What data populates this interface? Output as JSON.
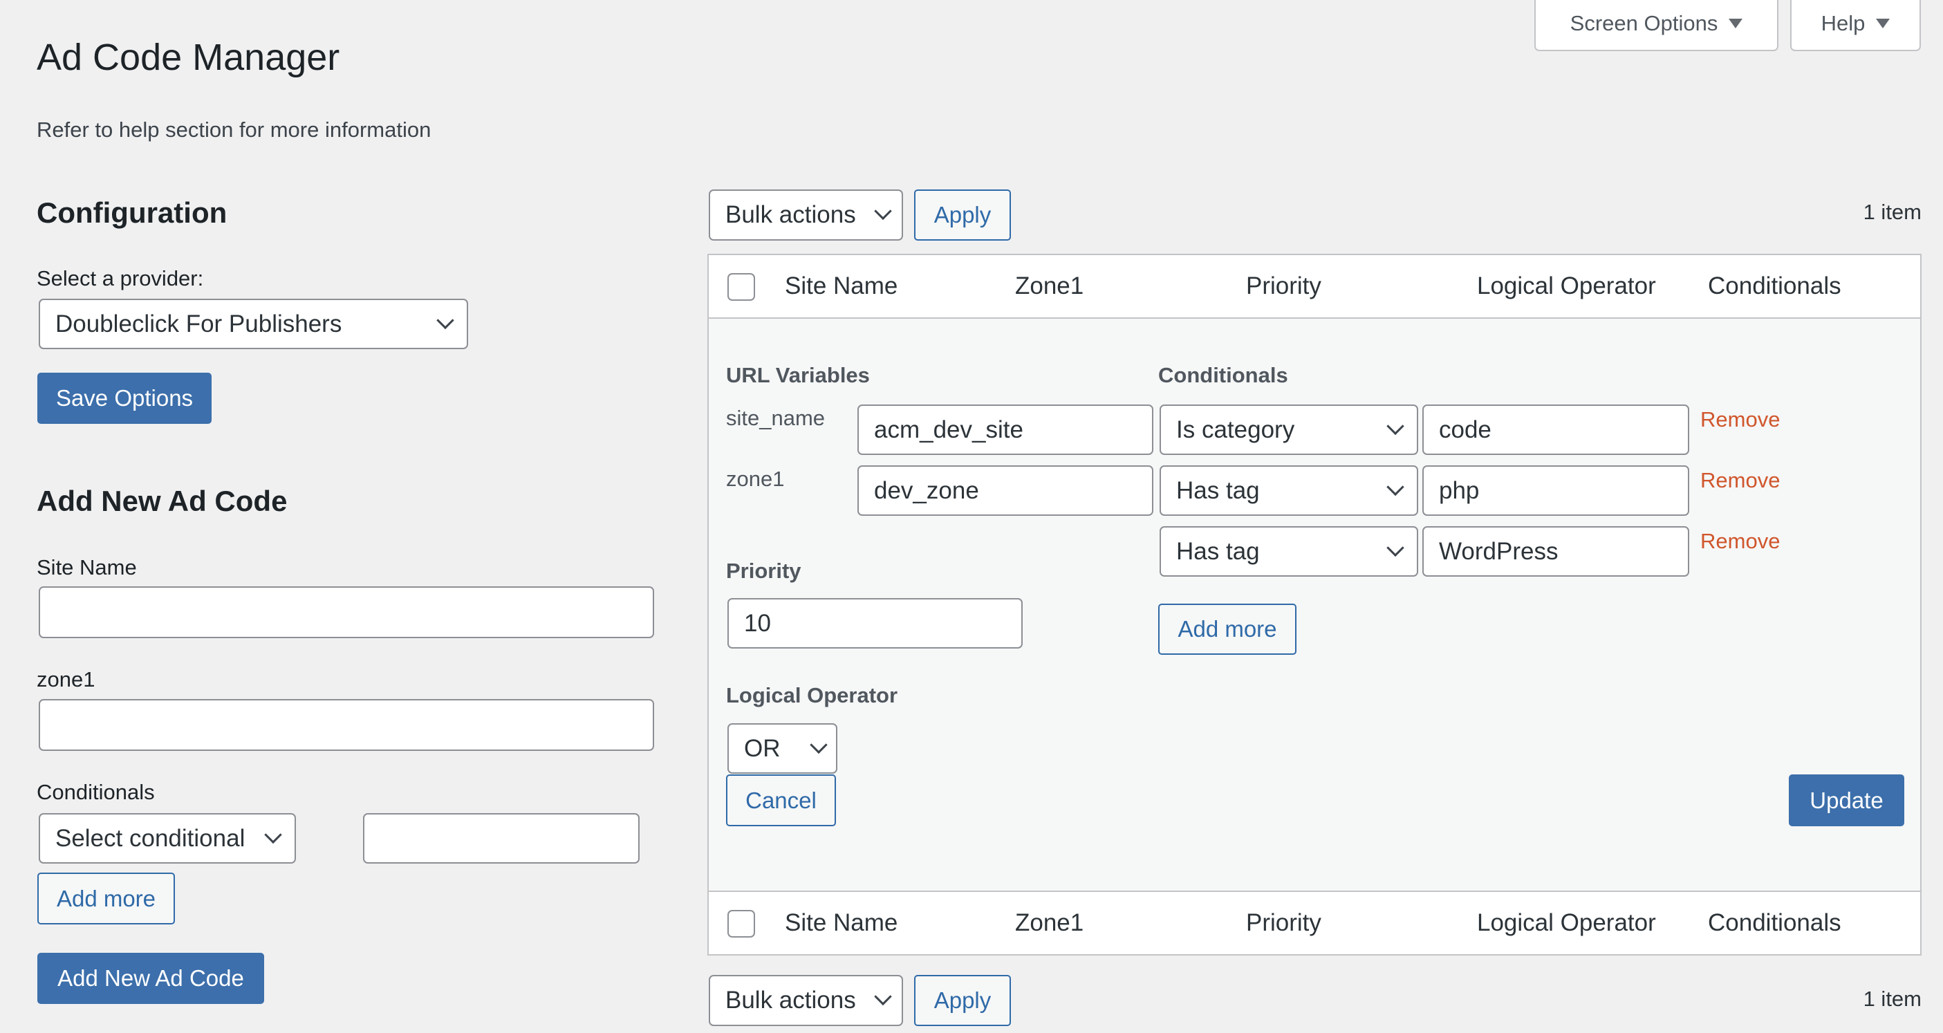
{
  "screen_meta": {
    "screen_options_label": "Screen Options",
    "help_label": "Help"
  },
  "page": {
    "title": "Ad Code Manager",
    "description": "Refer to help section for more information"
  },
  "configuration": {
    "heading": "Configuration",
    "provider_label": "Select a provider:",
    "provider_value": "Doubleclick For Publishers",
    "save_label": "Save Options"
  },
  "add_new": {
    "heading": "Add New Ad Code",
    "site_name_label": "Site Name",
    "site_name_value": "",
    "zone1_label": "zone1",
    "zone1_value": "",
    "conditionals_label": "Conditionals",
    "conditional_select_value": "Select conditional",
    "conditional_text_value": "",
    "add_more_label": "Add more",
    "submit_label": "Add New Ad Code"
  },
  "tablenav_top": {
    "bulk_actions_value": "Bulk actions",
    "apply_label": "Apply",
    "item_count": "1 item"
  },
  "tablenav_bottom": {
    "bulk_actions_value": "Bulk actions",
    "apply_label": "Apply",
    "item_count": "1 item"
  },
  "table": {
    "columns": [
      "Site Name",
      "Zone1",
      "Priority",
      "Logical Operator",
      "Conditionals"
    ]
  },
  "edit": {
    "url_variables_heading": "URL Variables",
    "url_variables": [
      {
        "name": "site_name",
        "value": "acm_dev_site"
      },
      {
        "name": "zone1",
        "value": "dev_zone"
      }
    ],
    "conditionals_heading": "Conditionals",
    "conditionals": [
      {
        "function": "Is category",
        "argument": "code",
        "remove_label": "Remove"
      },
      {
        "function": "Has tag",
        "argument": "php",
        "remove_label": "Remove"
      },
      {
        "function": "Has tag",
        "argument": "WordPress",
        "remove_label": "Remove"
      }
    ],
    "add_more_label": "Add more",
    "priority_label": "Priority",
    "priority_value": "10",
    "logical_operator_label": "Logical Operator",
    "logical_operator_value": "OR",
    "cancel_label": "Cancel",
    "update_label": "Update"
  },
  "colors": {
    "primary": "#3c6fab",
    "remove": "#d0562c",
    "background": "#f0f0f1"
  }
}
